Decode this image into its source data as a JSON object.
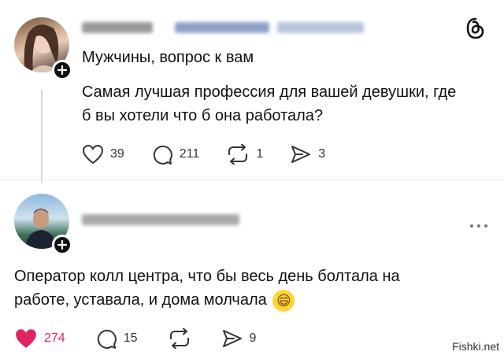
{
  "post1": {
    "title": "Мужчины, вопрос к вам",
    "body": "Самая лучшая профессия для вашей девушки, где б вы хотели что б она работала?",
    "likes": "39",
    "comments": "211",
    "reposts": "1",
    "shares": "3"
  },
  "reply": {
    "body": "Оператор колл центра, что бы весь день болтала на работе, уставала, и дома молчала",
    "emoji": "😄",
    "likes": "274",
    "comments": "15",
    "shares": "9"
  },
  "watermark": "Fishki.net",
  "colors": {
    "like_active": "#e0245e",
    "text": "#111111",
    "icon": "#333333"
  },
  "icons": [
    "threads-logo-icon",
    "heart-icon",
    "comment-icon",
    "repost-icon",
    "share-icon",
    "more-icon",
    "plus-icon"
  ]
}
